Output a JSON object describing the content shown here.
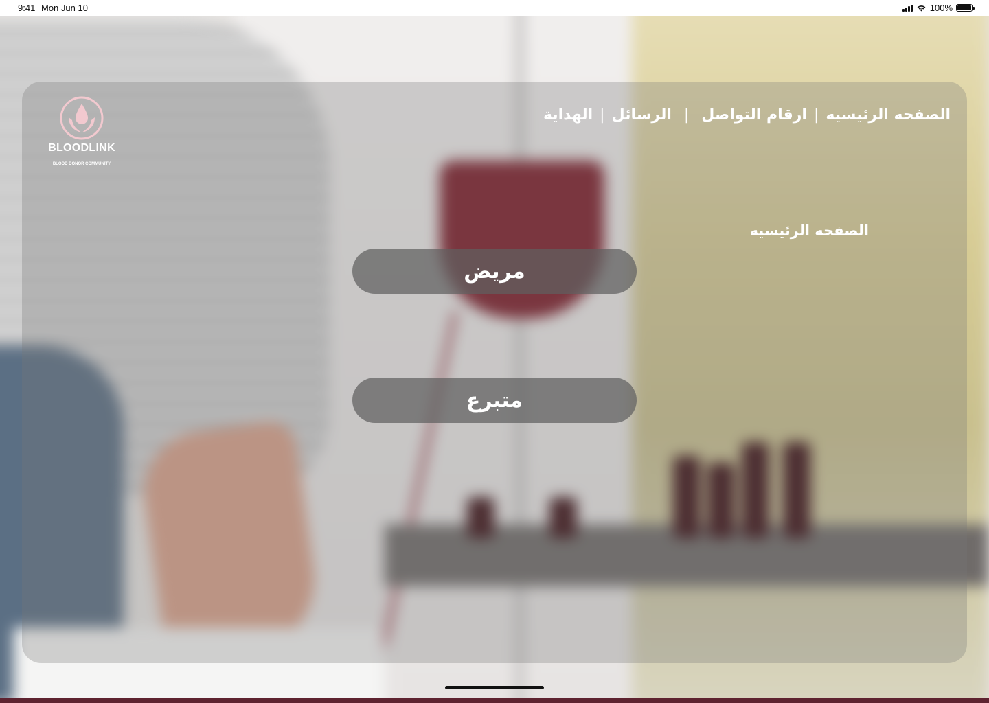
{
  "status_bar": {
    "time": "9:41",
    "date": "Mon Jun 10",
    "battery": "100%",
    "icons": [
      "signal-icon",
      "wifi-icon",
      "battery-icon"
    ]
  },
  "logo": {
    "title": "BLOODLINK",
    "subtitle": "BLOOD DONOR COMMUNITY",
    "icon": "blood-drop-hands-icon"
  },
  "nav": {
    "items": [
      {
        "label": "الصفحه الرئيسيه"
      },
      {
        "label": "ارقام التواصل"
      },
      {
        "label": "الرسائل"
      },
      {
        "label": "الهداية"
      }
    ],
    "separator": "|"
  },
  "main": {
    "heading": "الصفحه الرئيسيه",
    "buttons": {
      "patient": "مريض",
      "donor": "متبرع"
    }
  },
  "colors": {
    "card_overlay": "#787878",
    "button_fill": "#5f5f5f",
    "text": "#ffffff",
    "brand": "#7c1b28"
  }
}
